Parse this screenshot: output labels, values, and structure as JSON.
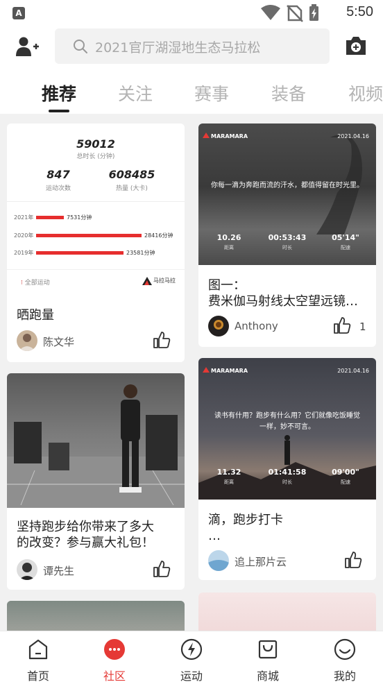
{
  "status_bar": {
    "app_badge": "A",
    "time": "5:50"
  },
  "header": {
    "search_placeholder": "2021官厅湖湿地生态马拉松"
  },
  "tabs": [
    {
      "label": "推荐"
    },
    {
      "label": "关注"
    },
    {
      "label": "赛事"
    },
    {
      "label": "装备"
    },
    {
      "label": "视频"
    }
  ],
  "feed": {
    "stats_card": {
      "total_minutes": "59012",
      "total_minutes_label": "总时长 (分钟)",
      "runs": "847",
      "runs_label": "运动次数",
      "calories": "608485",
      "calories_label": "热量 (大卡)",
      "bars": [
        {
          "year": "2021年",
          "value": "7531分钟",
          "minutes": 7531
        },
        {
          "year": "2020年",
          "value": "28416分钟",
          "minutes": 28416
        },
        {
          "year": "2019年",
          "value": "23581分钟",
          "minutes": 23581
        }
      ],
      "footer_left": "全部运动",
      "footer_right": "马拉马拉",
      "title": "晒跑量",
      "author": "陈文华"
    },
    "card_2": {
      "brand": "MARAMARA",
      "date": "2021.04.16",
      "quote": "你每一滴为奔跑而流的汗水，都值得留在时光里。",
      "metrics": [
        {
          "v": "10.26",
          "l": "距离"
        },
        {
          "v": "00:53:43",
          "l": "时长"
        },
        {
          "v": "05'14\"",
          "l": "配速"
        }
      ],
      "title_line1": "图一：",
      "title_line2": "费米伽马射线太空望远镜…",
      "author": "Anthony",
      "likes": "1"
    },
    "card_3": {
      "title_line1": "坚持跑步给你带来了多大",
      "title_line2": "的改变？参与赢大礼包！",
      "author": "谭先生"
    },
    "card_4": {
      "brand": "MARAMARA",
      "date": "2021.04.16",
      "quote_line1": "读书有什用？跑步有什么用？它们就像吃饭睡觉",
      "quote_line2": "一样，妙不可言。",
      "metrics": [
        {
          "v": "11.32",
          "l": "距离"
        },
        {
          "v": "01:41:58",
          "l": "时长"
        },
        {
          "v": "09'00\"",
          "l": "配速"
        }
      ],
      "title_line1": "滴，跑步打卡",
      "title_line2": "…",
      "author": "追上那片云"
    }
  },
  "bottom_nav": [
    {
      "label": "首页",
      "icon": "home-icon"
    },
    {
      "label": "社区",
      "icon": "community-icon",
      "active": true
    },
    {
      "label": "运动",
      "icon": "sport-icon"
    },
    {
      "label": "商城",
      "icon": "shop-icon"
    },
    {
      "label": "我的",
      "icon": "profile-icon"
    }
  ],
  "colors": {
    "accent": "#e53935",
    "bar": "#e62e2e"
  }
}
